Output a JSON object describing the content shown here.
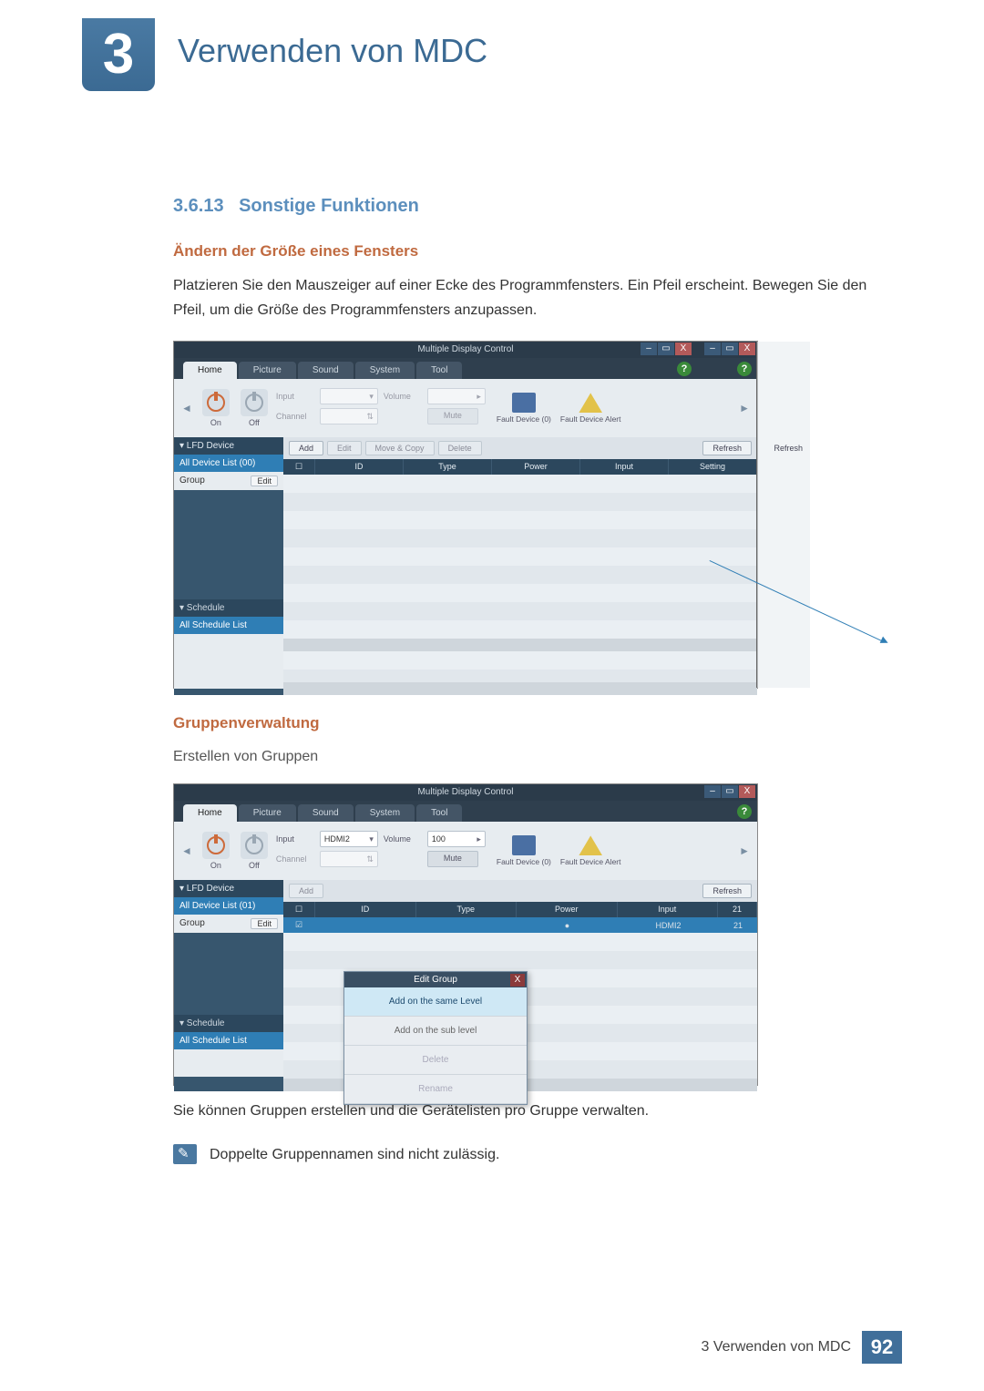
{
  "chapter_number": "3",
  "chapter_title": "Verwenden von MDC",
  "section_number": "3.6.13",
  "section_title": "Sonstige Funktionen",
  "sub1_title": "Ändern der Größe eines Fensters",
  "sub1_para": "Platzieren Sie den Mauszeiger auf einer Ecke des Programmfensters. Ein Pfeil erscheint. Bewegen Sie den Pfeil, um die Größe des Programmfensters anzupassen.",
  "sub2_title": "Gruppenverwaltung",
  "sub2_sub": "Erstellen von Gruppen",
  "sub2_para": "Sie können Gruppen erstellen und die Gerätelisten pro Gruppe verwalten.",
  "note_text": "Doppelte Gruppennamen sind nicht zulässig.",
  "footer_text": "3 Verwenden von MDC",
  "page_number": "92",
  "shot1": {
    "title": "Multiple Display Control",
    "help": "?",
    "tabs": {
      "home": "Home",
      "picture": "Picture",
      "sound": "Sound",
      "system": "System",
      "tool": "Tool"
    },
    "power": {
      "on": "On",
      "off": "Off"
    },
    "labels": {
      "input": "Input",
      "channel": "Channel",
      "volume": "Volume"
    },
    "vals": {
      "input": "",
      "channel": "",
      "volume": ""
    },
    "mute": "Mute",
    "fault": {
      "a": "Fault Device (0)",
      "b": "Fault Device Alert"
    },
    "side": {
      "lfd": "▾  LFD Device",
      "all": "All Device List (00)",
      "group": "Group",
      "edit": "Edit",
      "schedule": "▾  Schedule",
      "schedlist": "All Schedule List"
    },
    "toolbar": {
      "add": "Add",
      "edit": "Edit",
      "movecopy": "Move & Copy",
      "delete": "Delete",
      "refresh": "Refresh"
    },
    "cols": {
      "id": "ID",
      "type": "Type",
      "power": "Power",
      "input": "Input",
      "setting": "Setting"
    }
  },
  "shot2": {
    "title": "Multiple Display Control",
    "help": "?",
    "tabs": {
      "home": "Home",
      "picture": "Picture",
      "sound": "Sound",
      "system": "System",
      "tool": "Tool"
    },
    "power": {
      "on": "On",
      "off": "Off"
    },
    "labels": {
      "input": "Input",
      "channel": "Channel",
      "volume": "Volume"
    },
    "vals": {
      "input": "HDMI2",
      "channel": "",
      "volume": "100"
    },
    "mute": "Mute",
    "fault": {
      "a": "Fault Device (0)",
      "b": "Fault Device Alert"
    },
    "side": {
      "lfd": "▾  LFD Device",
      "all": "All Device List (01)",
      "group": "Group",
      "edit": "Edit",
      "schedule": "▾  Schedule",
      "schedlist": "All Schedule List"
    },
    "toolbar": {
      "add": "Add",
      "refresh": "Refresh"
    },
    "cols": {
      "id": "ID",
      "type": "Type",
      "power": "Power",
      "input": "Input",
      "num": "21"
    },
    "row": {
      "power": "●",
      "input": "HDMI2",
      "num": "21"
    },
    "dialog": {
      "title": "Edit Group",
      "close": "X",
      "opt1": "Add on the same Level",
      "opt2": "Add on the sub level",
      "opt3": "Delete",
      "opt4": "Rename"
    }
  }
}
